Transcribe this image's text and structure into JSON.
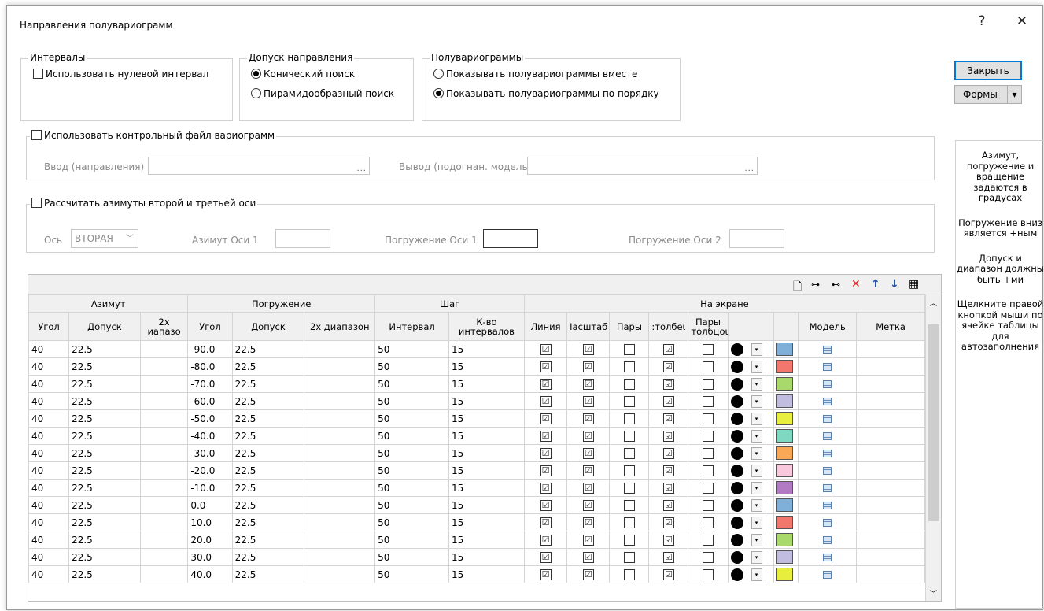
{
  "window": {
    "title": "Направления полувариограмм",
    "help_btn": "?",
    "close_btn": "✕"
  },
  "intervals": {
    "legend": "Интервалы",
    "zero_interval": "Использовать нулевой интервал"
  },
  "tolerance": {
    "legend": "Допуск направления",
    "conic": "Конический поиск",
    "pyramid": "Пирамидообразный поиск"
  },
  "semivar": {
    "legend": "Полувариограммы",
    "together": "Показывать полувариограммы вместе",
    "in_order": "Показывать полувариограммы по порядку"
  },
  "buttons": {
    "close": "Закрыть",
    "forms": "Формы",
    "forms_arrow": "▾"
  },
  "control_file": {
    "legend": "Использовать контрольный файл вариограмм",
    "input_label": "Ввод (направления)",
    "input_value": "",
    "output_label": "Вывод (подогнан. модель)",
    "output_value": "",
    "browse": "..."
  },
  "axes": {
    "legend": "Рассчитать азимуты второй и третьей оси",
    "axis_label": "Ось",
    "axis_value": "ВТОРАЯ",
    "azimuth1_label": "Азимут Оси 1",
    "azimuth1_value": "",
    "dip1_label": "Погружение Оси 1",
    "dip1_value": "",
    "dip2_label": "Погружение Оси 2",
    "dip2_value": ""
  },
  "help": [
    "Азимут, погружение и вращение задаются в градусах",
    "Погружение вниз является +ным",
    "Допуск и диапазон должны быть +ми",
    "Щелкните правой кнопкой мыши по ячейке таблицы для автозаполнения"
  ],
  "toolbar_icons": [
    "new-doc-icon",
    "insert-rows-icon",
    "append-rows-icon",
    "delete-icon",
    "move-up-icon",
    "move-down-icon",
    "calculator-icon"
  ],
  "table": {
    "groups": [
      "Азимут",
      "Погружение",
      "Шаг",
      "На экране"
    ],
    "columns": [
      "Угол",
      "Допуск",
      "2x иапазо",
      "Угол",
      "Допуск",
      "2x диапазон",
      "Интервал",
      "К-во интервалов",
      "Линия",
      "Іасштаб",
      ":толбеι",
      "Пары",
      "Пары толбцоι",
      "",
      "",
      "",
      "Модель",
      "Метка"
    ],
    "rows": [
      {
        "az": "40",
        "az_tol": "22.5",
        "dip": "-90.0",
        "dip_tol": "22.5",
        "interval": "50",
        "count": "15",
        "color": "#7fb0d9"
      },
      {
        "az": "40",
        "az_tol": "22.5",
        "dip": "-80.0",
        "dip_tol": "22.5",
        "interval": "50",
        "count": "15",
        "color": "#f4776d"
      },
      {
        "az": "40",
        "az_tol": "22.5",
        "dip": "-70.0",
        "dip_tol": "22.5",
        "interval": "50",
        "count": "15",
        "color": "#a9d96a"
      },
      {
        "az": "40",
        "az_tol": "22.5",
        "dip": "-60.0",
        "dip_tol": "22.5",
        "interval": "50",
        "count": "15",
        "color": "#c0bde0"
      },
      {
        "az": "40",
        "az_tol": "22.5",
        "dip": "-50.0",
        "dip_tol": "22.5",
        "interval": "50",
        "count": "15",
        "color": "#e8ee3e"
      },
      {
        "az": "40",
        "az_tol": "22.5",
        "dip": "-40.0",
        "dip_tol": "22.5",
        "interval": "50",
        "count": "15",
        "color": "#7fd9c2"
      },
      {
        "az": "40",
        "az_tol": "22.5",
        "dip": "-30.0",
        "dip_tol": "22.5",
        "interval": "50",
        "count": "15",
        "color": "#f9a855"
      },
      {
        "az": "40",
        "az_tol": "22.5",
        "dip": "-20.0",
        "dip_tol": "22.5",
        "interval": "50",
        "count": "15",
        "color": "#f9c8dc"
      },
      {
        "az": "40",
        "az_tol": "22.5",
        "dip": "-10.0",
        "dip_tol": "22.5",
        "interval": "50",
        "count": "15",
        "color": "#b27ac2"
      },
      {
        "az": "40",
        "az_tol": "22.5",
        "dip": "0.0",
        "dip_tol": "22.5",
        "interval": "50",
        "count": "15",
        "color": "#7fb0d9"
      },
      {
        "az": "40",
        "az_tol": "22.5",
        "dip": "10.0",
        "dip_tol": "22.5",
        "interval": "50",
        "count": "15",
        "color": "#f4776d"
      },
      {
        "az": "40",
        "az_tol": "22.5",
        "dip": "20.0",
        "dip_tol": "22.5",
        "interval": "50",
        "count": "15",
        "color": "#a9d96a"
      },
      {
        "az": "40",
        "az_tol": "22.5",
        "dip": "30.0",
        "dip_tol": "22.5",
        "interval": "50",
        "count": "15",
        "color": "#c0bde0"
      },
      {
        "az": "40",
        "az_tol": "22.5",
        "dip": "40.0",
        "dip_tol": "22.5",
        "interval": "50",
        "count": "15",
        "color": "#e8ee3e"
      }
    ],
    "check_symbol": "☑"
  }
}
